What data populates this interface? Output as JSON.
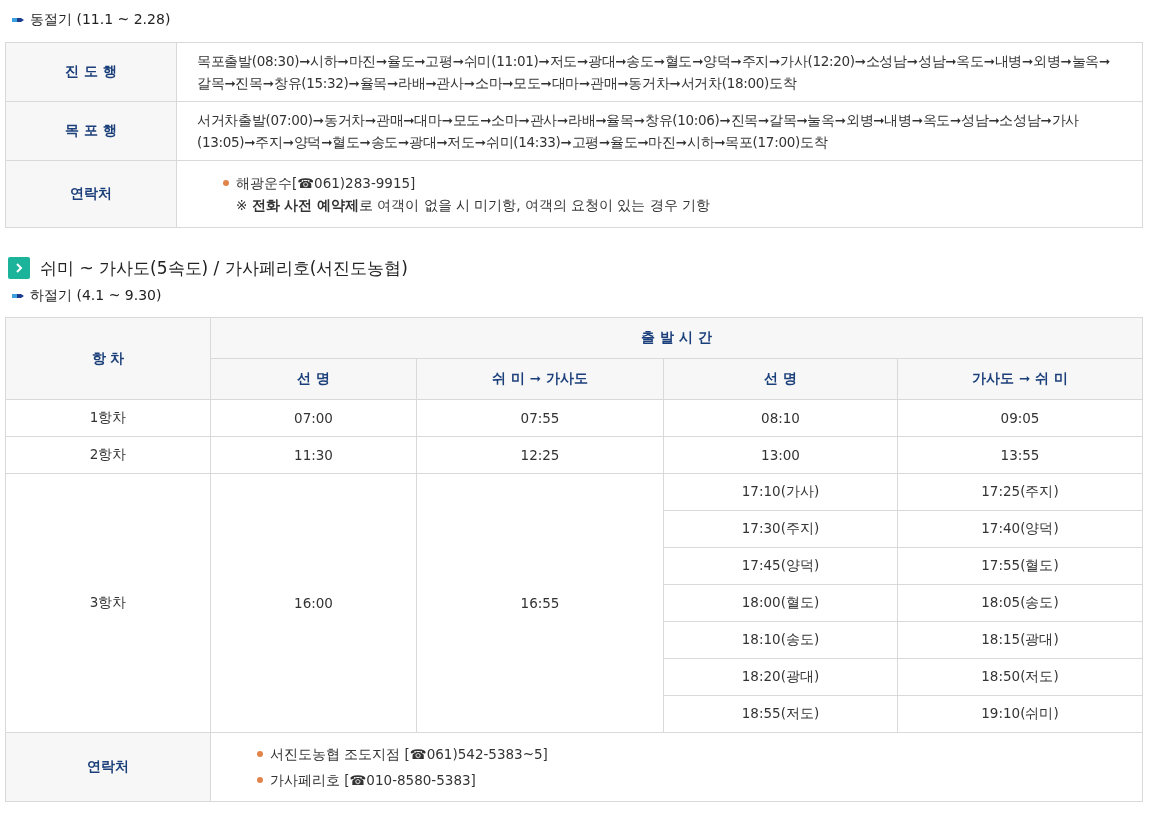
{
  "winter": {
    "season": "동절기 (11.1 ~ 2.28)",
    "routes": [
      {
        "label": "진 도 행",
        "text": "목포출발(08:30)➞시하➞마진➞율도➞고평➞쉬미(11:01)➞저도➞광대➞송도➞혈도➞양덕➞주지➞가사(12:20)➞소성남➞성남➞옥도➞내병➞외병➞눌옥➞갈목➞진목➞창유(15:32)➞율목➞라배➞관사➞소마➞모도➞대마➞관매➞동거차➞서거차(18:00)도착"
      },
      {
        "label": "목 포 행",
        "text": "서거차출발(07:00)➞동거차➞관매➞대마➞모도➞소마➞관사➞라배➞율목➞창유(10:06)➞진목➞갈목➞눌옥➞외병➞내병➞옥도➞성남➞소성남➞가사(13:05)➞주지➞양덕➞혈도➞송도➞광대➞저도➞쉬미(14:33)➞고평➞율도➞마진➞시하➞목포(17:00)도착"
      }
    ],
    "contact": {
      "label": "연락처",
      "items": [
        "해광운수[☎061)283-9915]"
      ],
      "note": "※ **전화 사전 예약제**로 여객이 없을 시 미기항, 여객의 요청이 있는 경우 기항"
    }
  },
  "section_title": "쉬미 ~ 가사도(5속도) / 가사페리호(서진도농협)",
  "summer": {
    "season": "하절기 (4.1 ~ 9.30)",
    "header": {
      "trip": "항 차",
      "group": "출 발 시 간",
      "columns": [
        "선 명",
        "쉬 미 ➞ 가사도",
        "선 명",
        "가사도 ➞ 쉬 미"
      ]
    },
    "trips": [
      {
        "name": "1항차",
        "col1": "07:00",
        "col2": "07:55",
        "subrows": [
          [
            "08:10",
            "09:05"
          ]
        ]
      },
      {
        "name": "2항차",
        "col1": "11:30",
        "col2": "12:25",
        "subrows": [
          [
            "13:00",
            "13:55"
          ]
        ]
      },
      {
        "name": "3항차",
        "col1": "16:00",
        "col2": "16:55",
        "subrows": [
          [
            "17:10(가사)",
            "17:25(주지)"
          ],
          [
            "17:30(주지)",
            "17:40(양덕)"
          ],
          [
            "17:45(양덕)",
            "17:55(혈도)"
          ],
          [
            "18:00(혈도)",
            "18:05(송도)"
          ],
          [
            "18:10(송도)",
            "18:15(광대)"
          ],
          [
            "18:20(광대)",
            "18:50(저도)"
          ],
          [
            "18:55(저도)",
            "19:10(쉬미)"
          ]
        ]
      }
    ],
    "contact": {
      "label": "연락처",
      "items": [
        "서진도농협 조도지점 [☎061)542-5383~5]",
        "가사페리호 [☎010-8580-5383]"
      ]
    }
  }
}
